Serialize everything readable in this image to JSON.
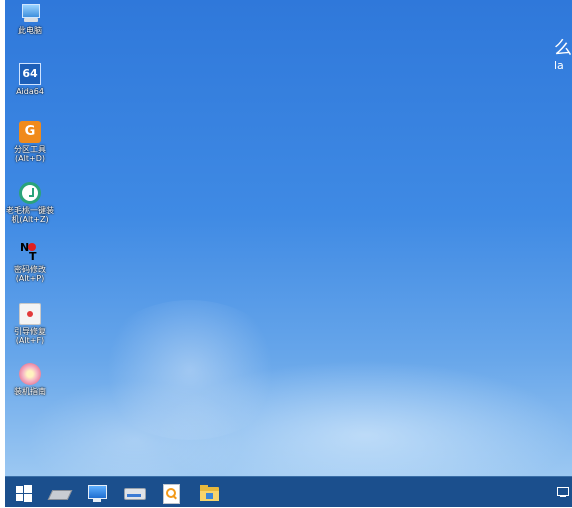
{
  "desktop": {
    "icons": [
      {
        "label": "此电脑",
        "icon": "computer-icon"
      },
      {
        "label": "Aida64",
        "icon": "aida64-icon"
      },
      {
        "label": "分区工具\n(Alt+D)",
        "icon": "diskgenius-icon"
      },
      {
        "label": "老毛桃一键装\n机(Alt+Z)",
        "icon": "one-key-install-icon"
      },
      {
        "label": "密码修改\n(Alt+P)",
        "icon": "password-reset-icon"
      },
      {
        "label": "引导修复\n(Alt+F)",
        "icon": "boot-repair-icon"
      },
      {
        "label": "装机指南",
        "icon": "install-guide-icon"
      }
    ],
    "brand": {
      "glyph": "么",
      "sub": "la"
    },
    "colors": {
      "top": "#2f78da",
      "bottom": "#9cc8f2"
    }
  },
  "taskbar": {
    "color": "#1b4f8d",
    "items": [
      {
        "icon": "windows-start-icon"
      },
      {
        "icon": "chip-memory-icon"
      },
      {
        "icon": "monitor-icon"
      },
      {
        "icon": "disk-drive-icon"
      },
      {
        "icon": "search-document-icon"
      },
      {
        "icon": "folder-icon"
      }
    ],
    "tray": {
      "icon": "network-tray-icon"
    }
  }
}
